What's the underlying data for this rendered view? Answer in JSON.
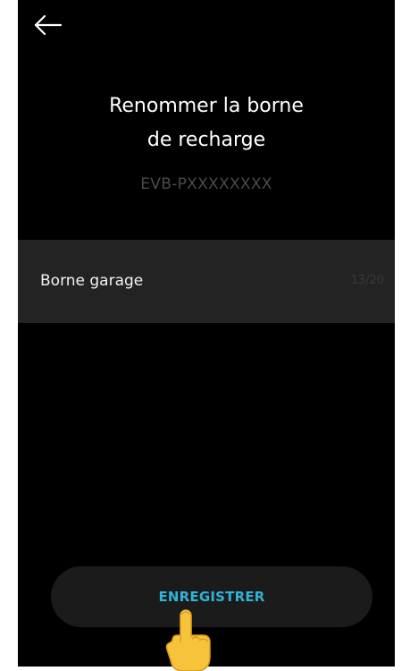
{
  "header": {
    "back_icon": "arrow-left-icon"
  },
  "title": {
    "line1": "Renommer la borne",
    "line2": "de recharge"
  },
  "charger_id": "EVB-PXXXXXXXX",
  "name_field": {
    "value": "Borne garage",
    "counter": "13/20"
  },
  "actions": {
    "save_label": "ENREGISTRER"
  },
  "overlay": {
    "icon": "pointing-hand-icon"
  },
  "colors": {
    "background": "#000000",
    "field_background": "#232323",
    "button_background": "#1b1b1b",
    "accent": "#2fb3d6",
    "hand": "#f6c33b"
  }
}
